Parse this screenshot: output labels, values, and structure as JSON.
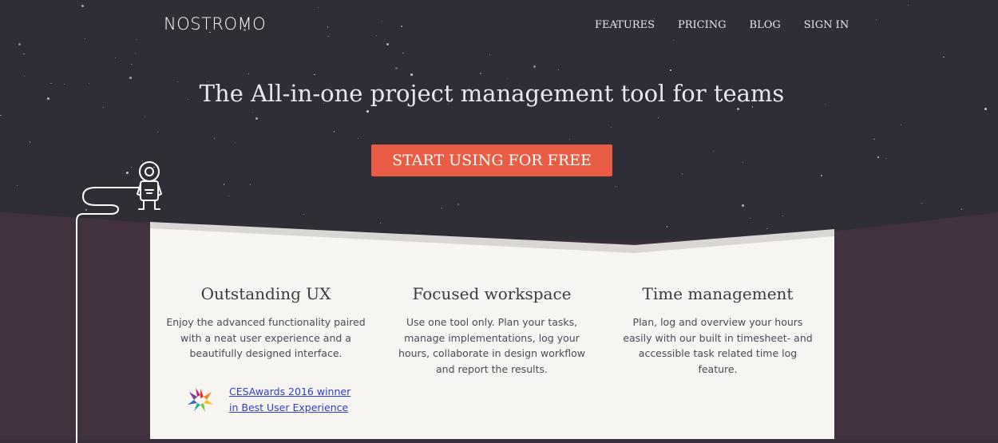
{
  "header": {
    "logo": "NOSTROMO",
    "nav": [
      "FEATURES",
      "PRICING",
      "BLOG",
      "SIGN IN"
    ]
  },
  "hero": {
    "title": "The All-in-one project management tool for teams",
    "cta_label": "START USING FOR FREE"
  },
  "features": [
    {
      "title": "Outstanding UX",
      "text": "Enjoy the advanced functionality paired with a neat user experience and a beautifully designed interface."
    },
    {
      "title": "Focused workspace",
      "text": "Use one tool only. Plan your tasks, manage implementations, log your hours, collaborate in design workflow and report the results."
    },
    {
      "title": "Time management",
      "text": "Plan, log and overview your hours easily with our built in timesheet- and accessible task related time log feature."
    }
  ],
  "award": {
    "line1": "CESAwards 2016 winner",
    "line2": "in Best User Experience"
  },
  "colors": {
    "sky": "#2f2e37",
    "ground": "#42323f",
    "accent": "#e85d44",
    "panel": "#f7f5f2"
  },
  "icons": [
    "astronaut-icon",
    "award-logo-icon"
  ]
}
